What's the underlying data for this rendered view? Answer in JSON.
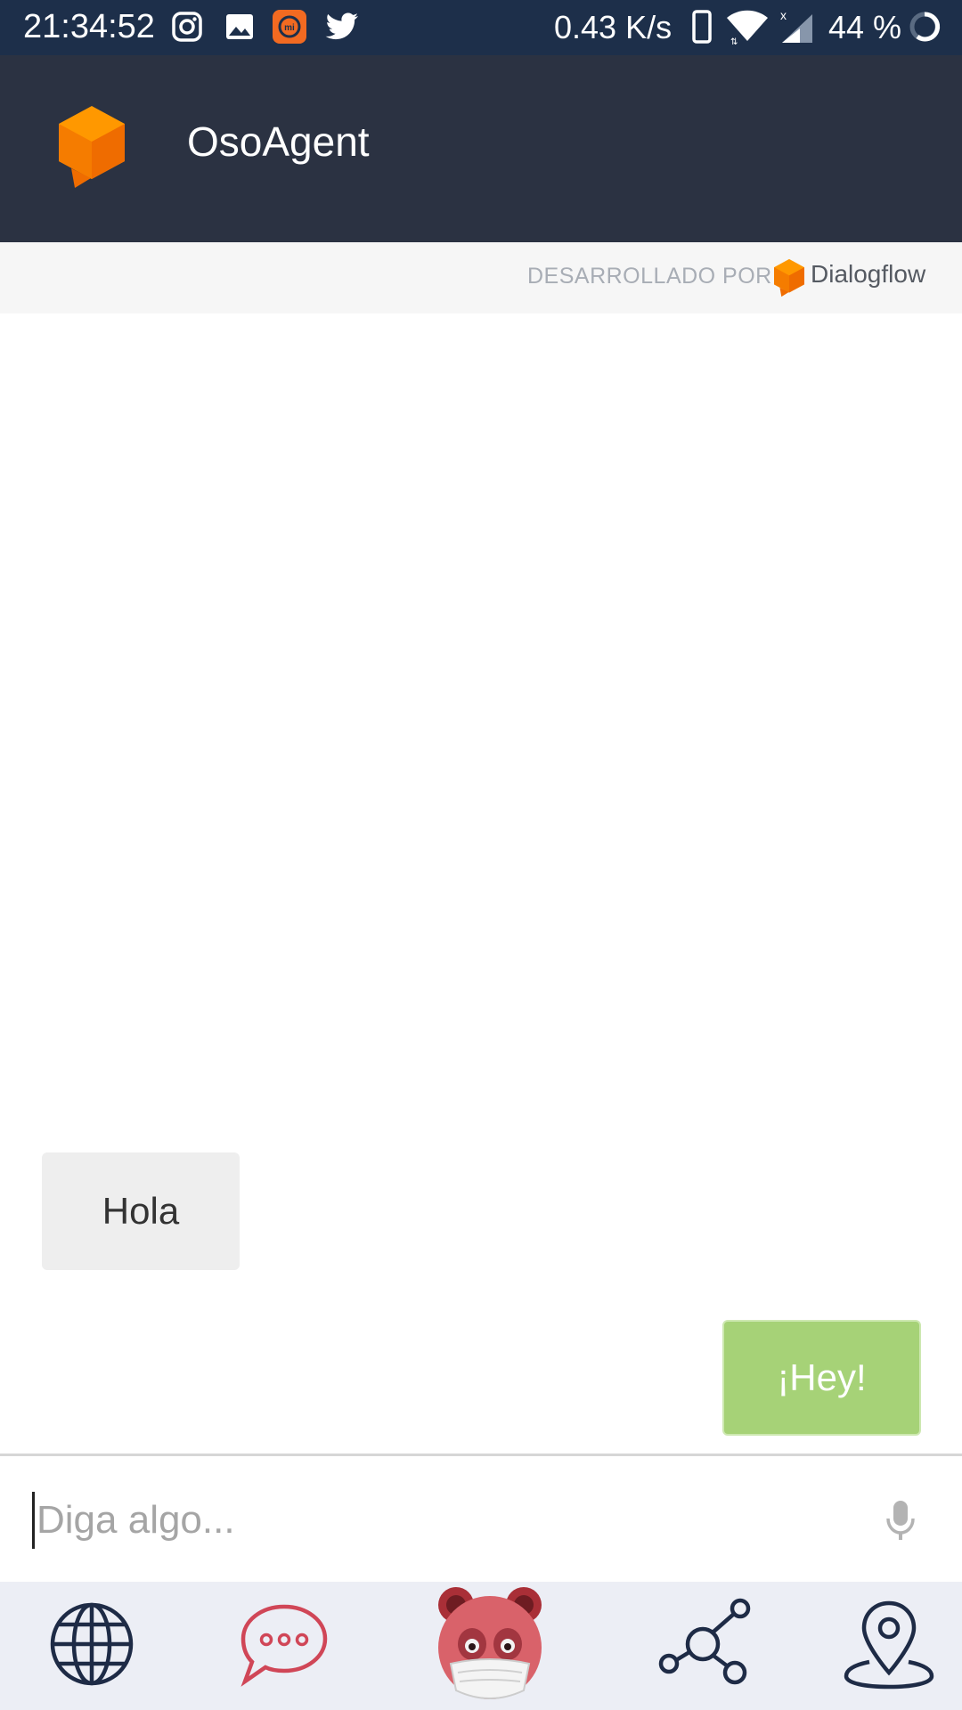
{
  "status_bar": {
    "time": "21:34:52",
    "network_speed": "0.43 K/s",
    "battery": "44 %",
    "icons": [
      "instagram-icon",
      "gallery-icon",
      "mi-icon",
      "twitter-icon",
      "phone-icon",
      "wifi-icon",
      "signal-icon",
      "battery-ring-icon"
    ]
  },
  "app_bar": {
    "title": "OsoAgent",
    "logo_icon": "dialogflow-cube-icon",
    "accent": "#f57c00"
  },
  "powered_by": {
    "label": "DESARROLLADO POR",
    "brand": "Dialogflow"
  },
  "messages": [
    {
      "from": "user",
      "text": "Hola"
    },
    {
      "from": "agent",
      "text": "¡Hey!"
    }
  ],
  "input": {
    "placeholder": "Diga algo...",
    "value": "",
    "mic_icon": "microphone-icon"
  },
  "bottom_nav": {
    "items": [
      {
        "icon": "globe-icon"
      },
      {
        "icon": "chat-bubble-icon"
      },
      {
        "icon": "bear-mask-icon"
      },
      {
        "icon": "network-icon"
      },
      {
        "icon": "location-pin-icon"
      }
    ]
  },
  "colors": {
    "status_bar_bg": "#1d2f4a",
    "app_bar_bg": "#2b3242",
    "agent_bubble": "#a6d277",
    "user_bubble": "#eeeeee",
    "nav_bg": "#eceef5"
  }
}
